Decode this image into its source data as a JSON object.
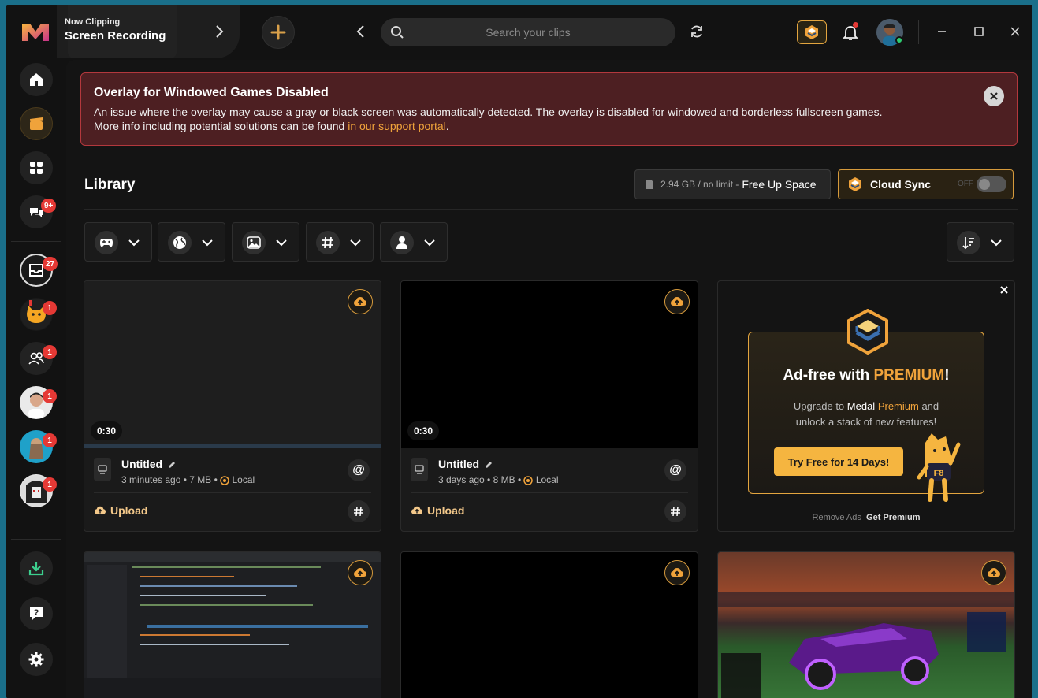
{
  "header": {
    "now_clipping_label": "Now Clipping",
    "now_clipping_mode": "Screen Recording",
    "search_placeholder": "Search your clips"
  },
  "sidebar": {
    "badges": {
      "chat": "9+",
      "inbox": "27",
      "friend1": "1",
      "friend2": "1",
      "friend3": "1",
      "friend4": "1",
      "friend5": "1"
    }
  },
  "alert": {
    "title": "Overlay for Windowed Games Disabled",
    "line1": "An issue where the overlay may cause a gray or black screen was automatically detected. The overlay is disabled for windowed and borderless fullscreen games.",
    "line2_prefix": "More info including potential solutions can be found ",
    "line2_link": "in our support portal",
    "line2_suffix": "."
  },
  "library": {
    "title": "Library",
    "storage_used": "2.94 GB / no limit -",
    "free_up_label": "Free Up Space",
    "cloud_sync_label": "Cloud Sync",
    "cloud_sync_state": "OFF"
  },
  "clips": [
    {
      "duration": "0:30",
      "title": "Untitled",
      "age": "3 minutes ago",
      "size": "7 MB",
      "location": "Local",
      "upload_label": "Upload"
    },
    {
      "duration": "0:30",
      "title": "Untitled",
      "age": "3 days ago",
      "size": "8 MB",
      "location": "Local",
      "upload_label": "Upload"
    }
  ],
  "ad": {
    "title_prefix": "Ad-free with ",
    "title_premium": "PREMIUM",
    "title_suffix": "!",
    "sub_1": "Upgrade to ",
    "sub_medal": "Medal",
    "sub_premium": " Premium",
    "sub_2": " and",
    "sub_3": "unlock a stack of new features!",
    "cta": "Try Free for 14 Days!",
    "mascot_text": "F8",
    "footer_remove": "Remove Ads",
    "footer_get": "Get Premium"
  },
  "colors": {
    "accent_gold": "#f0a33b",
    "alert_bg": "#4d1f22",
    "alert_border": "#b3383d",
    "badge_red": "#e53935"
  }
}
